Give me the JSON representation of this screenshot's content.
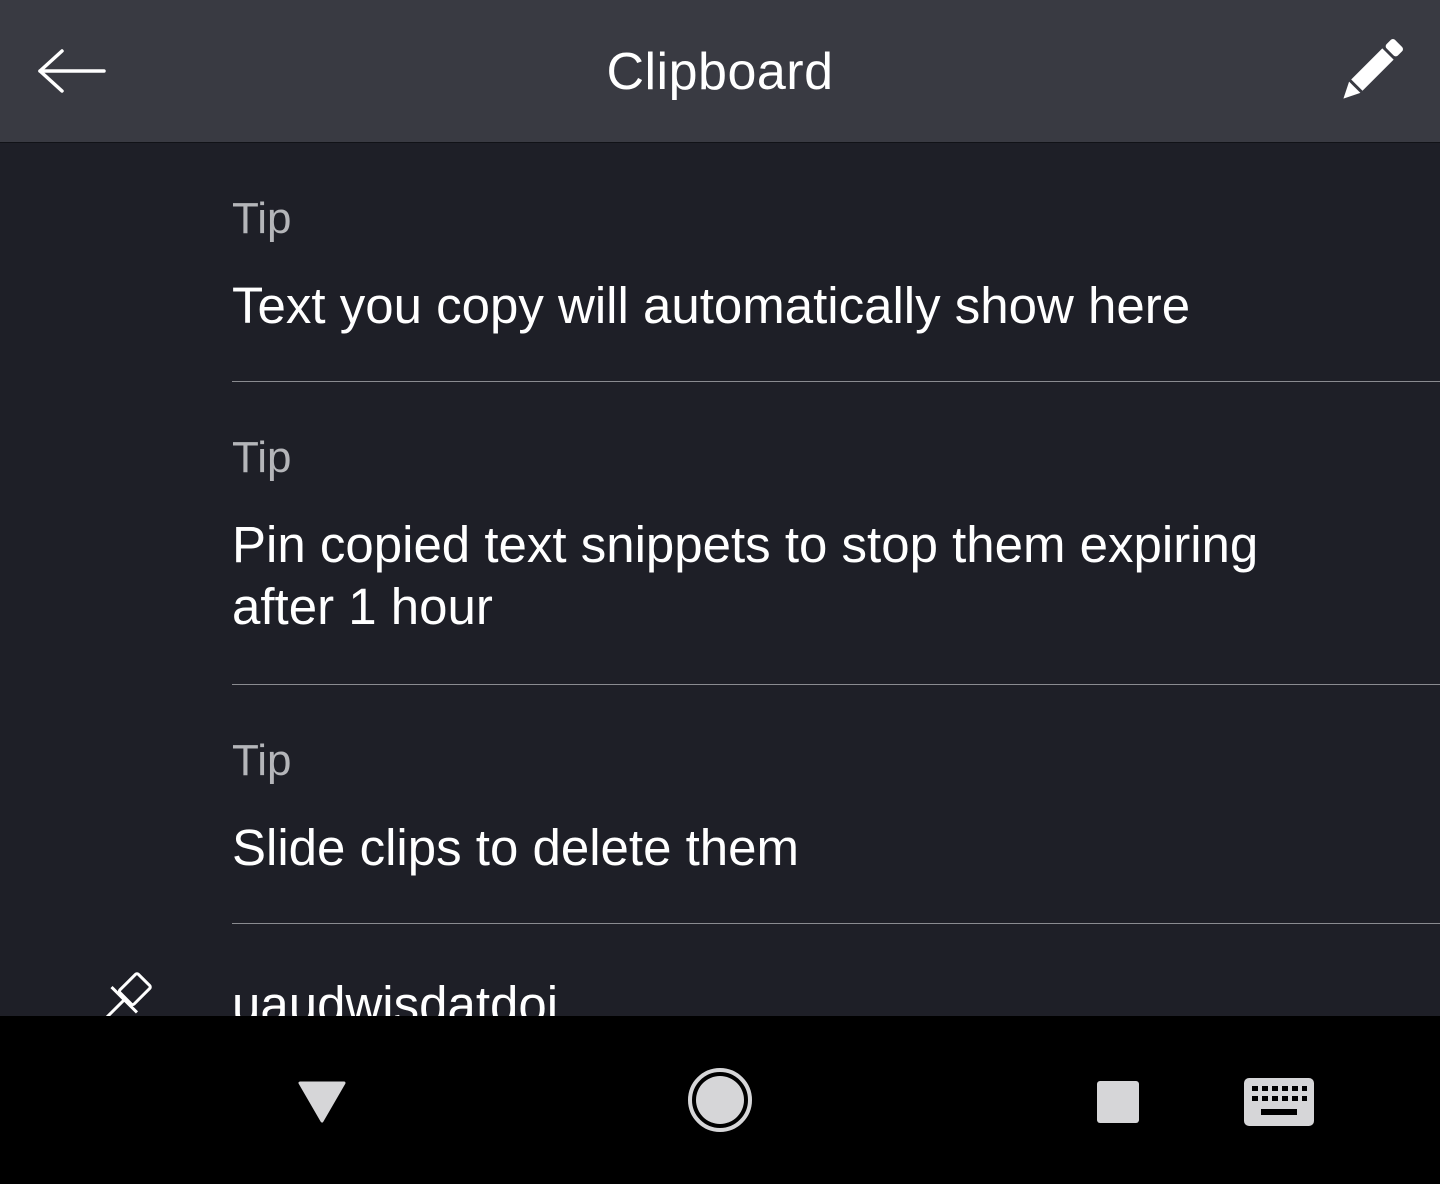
{
  "header": {
    "title": "Clipboard",
    "back_icon": "arrow-left-icon",
    "edit_icon": "pencil-icon"
  },
  "tips": [
    {
      "label": "Tip",
      "text": "Text you copy will automatically show here"
    },
    {
      "label": "Tip",
      "text": "Pin copied text snippets to stop them expiring after 1 hour"
    },
    {
      "label": "Tip",
      "text": "Slide clips to delete them"
    }
  ],
  "clip": {
    "icon": "pin-icon",
    "text": "uaudwisdatdoi"
  },
  "navbar": {
    "back_icon": "triangle-down-icon",
    "home_icon": "circle-home-icon",
    "recents_icon": "square-recents-icon",
    "keyboard_icon": "keyboard-icon"
  },
  "colors": {
    "header_bg": "#393a42",
    "content_bg": "#1e1f27",
    "divider": "#8a8b90",
    "label": "#b4b5b9",
    "text": "#ffffff",
    "navbar_bg": "#000000"
  }
}
